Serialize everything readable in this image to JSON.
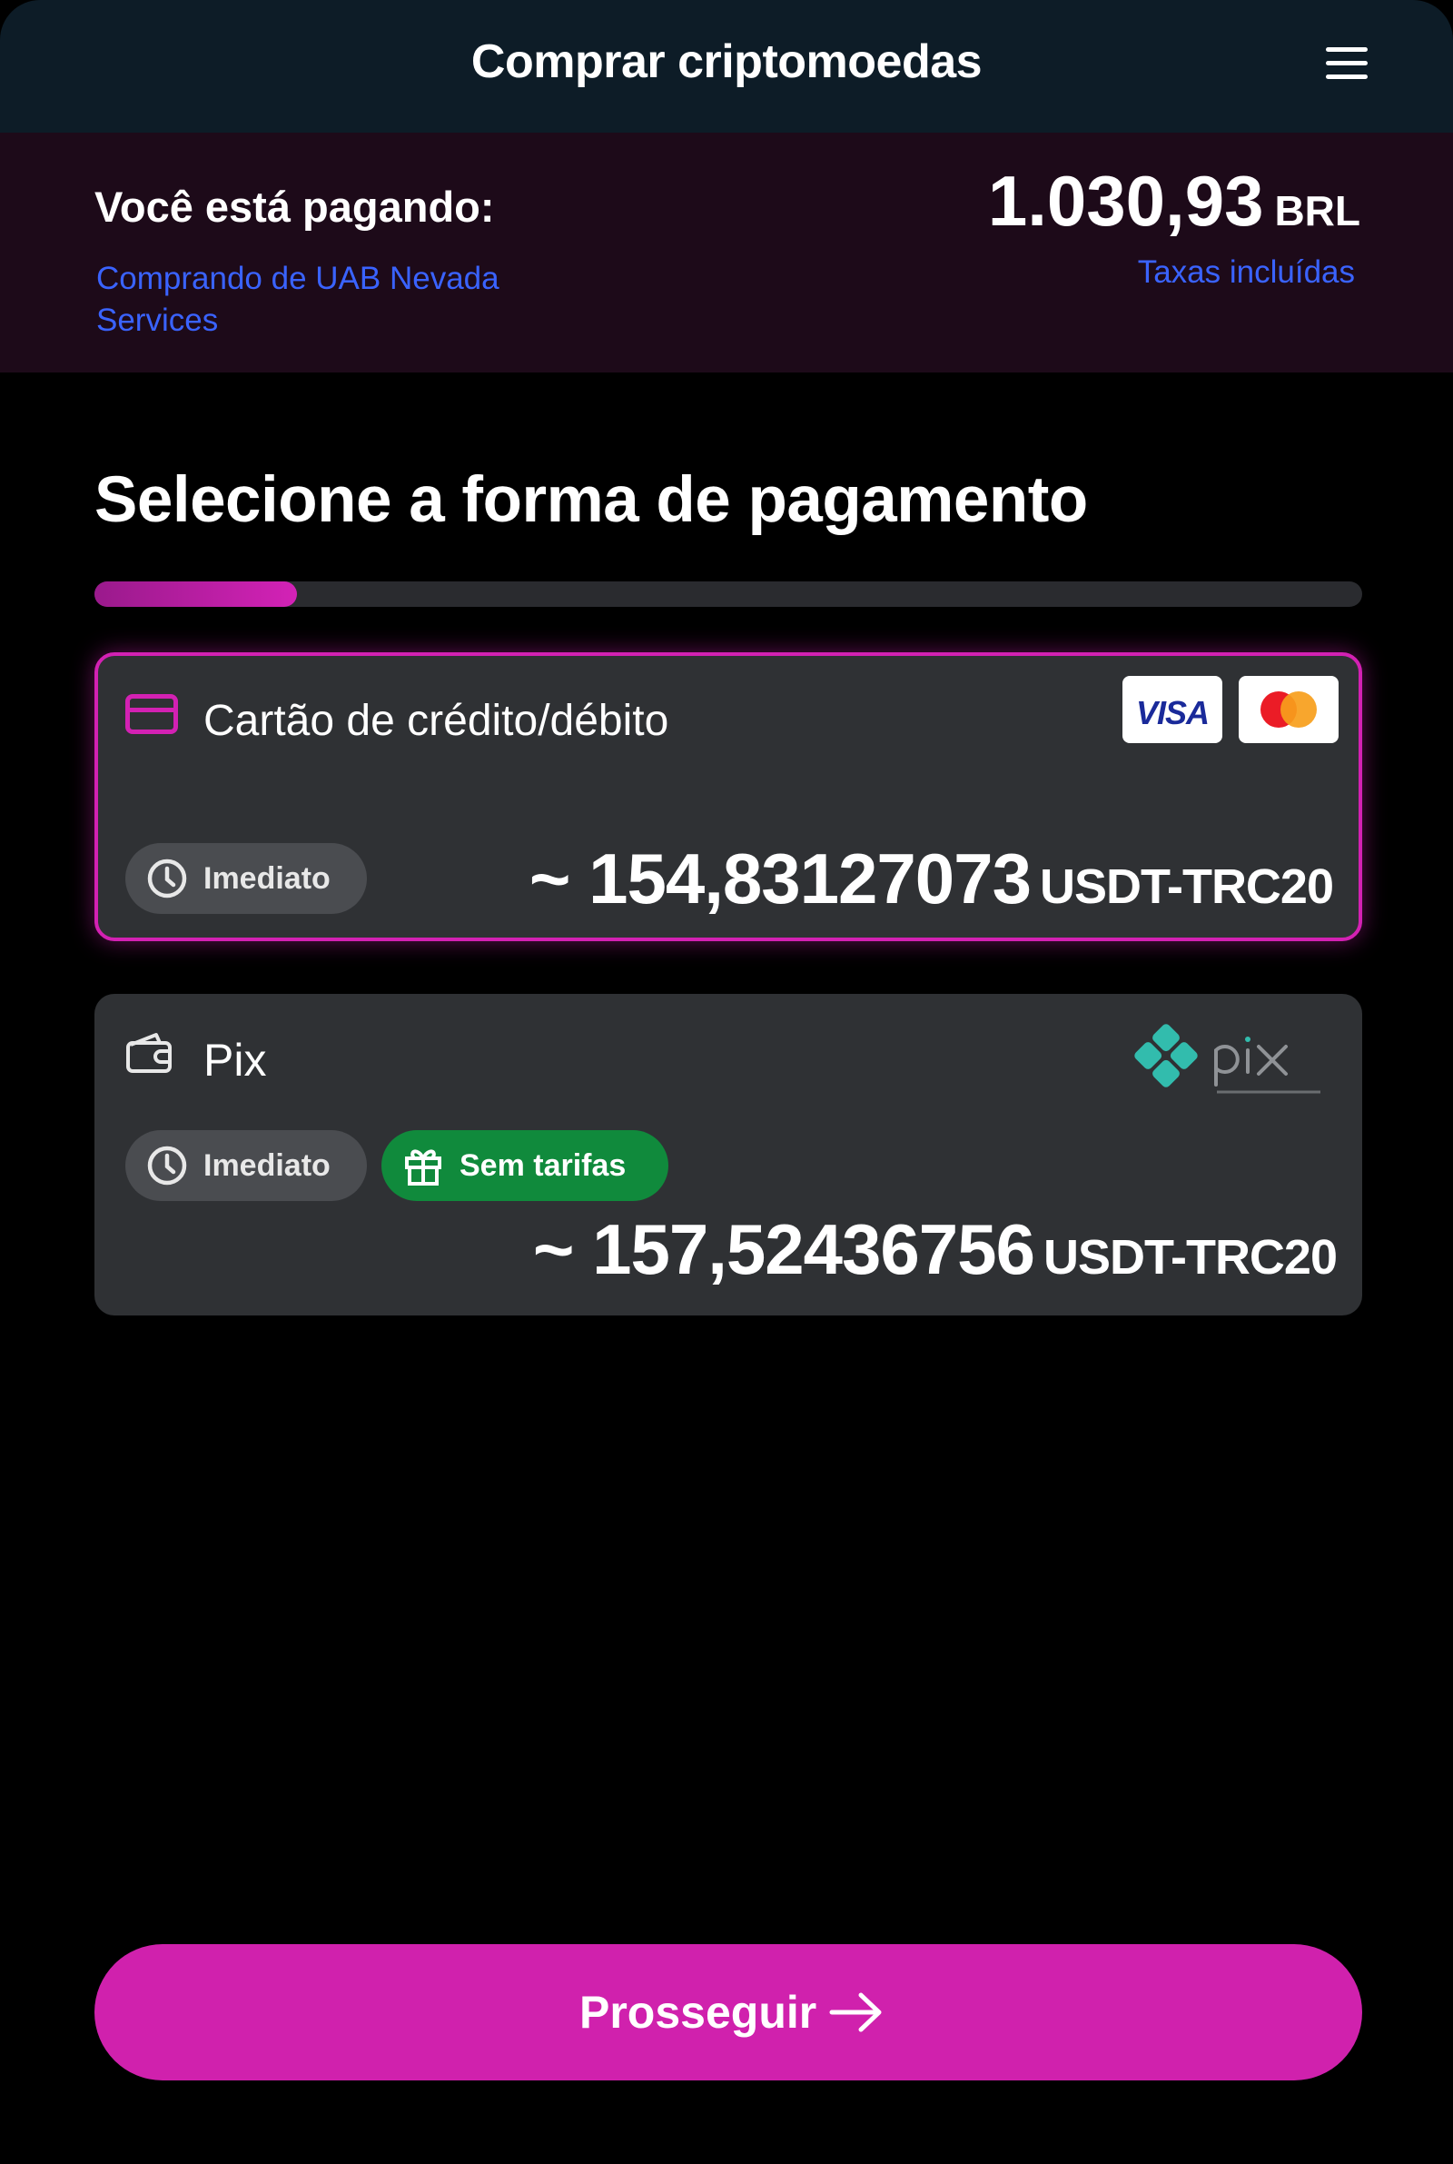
{
  "header": {
    "title": "Comprar criptomoedas",
    "menu_icon": "menu-icon"
  },
  "summary": {
    "pay_label": "Você está pagando:",
    "merchant": "Comprando de UAB Nevada Services",
    "amount": "1.030,93",
    "currency": "BRL",
    "fees_note": "Taxas incluídas"
  },
  "main": {
    "title": "Selecione a forma de pagamento",
    "progress": 0.16
  },
  "payment_methods": [
    {
      "name": "Cartão de crédito/débito",
      "icon": "credit-card-icon",
      "brands": [
        "VISA",
        "Mastercard"
      ],
      "speed_badge": "Imediato",
      "crypto_amount": "~ 154,83127073",
      "crypto_unit": "USDT-TRC20",
      "selected": true
    },
    {
      "name": "Pix",
      "icon": "wallet-icon",
      "logo": "pix-logo",
      "speed_badge": "Imediato",
      "fee_badge": "Sem tarifas",
      "crypto_amount": "~ 157,52436756",
      "crypto_unit": "USDT-TRC20",
      "selected": false
    }
  ],
  "cta": {
    "label": "Prosseguir",
    "icon": "arrow-right-icon"
  },
  "colors": {
    "accent": "#d021ad",
    "link": "#3a63ff",
    "card_bg": "#2f3134",
    "success": "#108a3c",
    "header_bg": "#0d1c27",
    "summary_bg": "#1d0a19"
  }
}
